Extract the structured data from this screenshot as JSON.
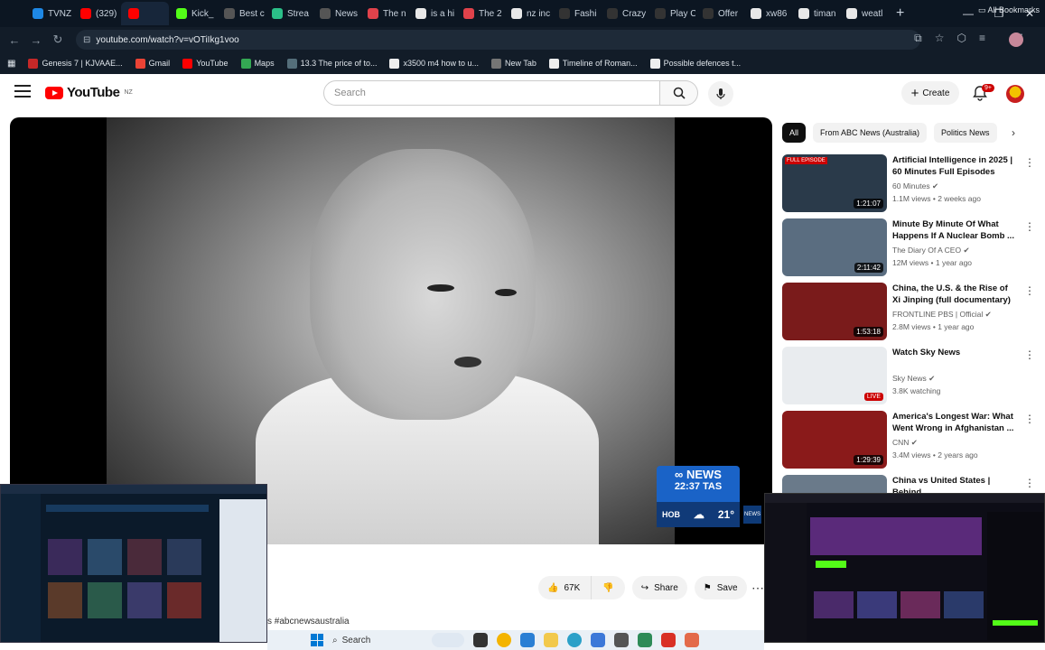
{
  "browser": {
    "tabs": [
      {
        "label": "TVNZ",
        "color": "#1e88e5"
      },
      {
        "label": "(329)",
        "color": "#ff0000"
      },
      {
        "label": "",
        "color": "#ff0000",
        "active": true
      },
      {
        "label": "Kick_",
        "color": "#53fc18"
      },
      {
        "label": "Best c",
        "color": "#555555"
      },
      {
        "label": "Strea",
        "color": "#2bbf88"
      },
      {
        "label": "News",
        "color": "#555555"
      },
      {
        "label": "The n",
        "color": "#e0424b"
      },
      {
        "label": "is a hi",
        "color": "#e8e8e8"
      },
      {
        "label": "The 2",
        "color": "#e0424b"
      },
      {
        "label": "nz inc",
        "color": "#e8e8e8"
      },
      {
        "label": "Fashi",
        "color": "#333333"
      },
      {
        "label": "Crazy",
        "color": "#333333"
      },
      {
        "label": "Play C",
        "color": "#333333"
      },
      {
        "label": "Offer",
        "color": "#333333"
      },
      {
        "label": "xw86",
        "color": "#e8e8e8"
      },
      {
        "label": "timan",
        "color": "#e8e8e8"
      },
      {
        "label": "weatl",
        "color": "#e8e8e8"
      }
    ],
    "new_tab": "+",
    "url": "youtube.com/watch?v=vOTiIkg1voo",
    "bookmarks": [
      {
        "label": "Genesis 7 | KJVAAE...",
        "color": "#c62828"
      },
      {
        "label": "Gmail",
        "color": "#ea4335"
      },
      {
        "label": "YouTube",
        "color": "#ff0000"
      },
      {
        "label": "Maps",
        "color": "#34a853"
      },
      {
        "label": "13.3 The price of to...",
        "color": "#546e7a"
      },
      {
        "label": "x3500 m4 how to u...",
        "color": "#eeeeee"
      },
      {
        "label": "New Tab",
        "color": "#757575"
      },
      {
        "label": "Timeline of Roman...",
        "color": "#eeeeee"
      },
      {
        "label": "Possible defences t...",
        "color": "#eeeeee"
      }
    ],
    "all_bookmarks": "All Bookmarks"
  },
  "youtube": {
    "logo_word": "YouTube",
    "logo_region": "NZ",
    "search_placeholder": "Search",
    "create_label": "Create",
    "notif_badge": "9+"
  },
  "video": {
    "overlay_brand": "NEWS",
    "overlay_time": "22:37 TAS",
    "overlay_city": "HOB",
    "overlay_temp": "21°",
    "likes": "67K",
    "share_label": "Share",
    "save_label": "Save",
    "hashtag": "s #abcnewsaustralia"
  },
  "sidebar": {
    "chips": [
      "All",
      "From ABC News (Australia)",
      "Politics News"
    ],
    "recommendations": [
      {
        "title": "Artificial Intelligence in 2025 | 60 Minutes Full Episodes",
        "channel": "60 Minutes",
        "meta": "1.1M views • 2 weeks ago",
        "duration": "1:21:07",
        "tag": "FULL EPISODE",
        "thumb": "#2a3a4a"
      },
      {
        "title": "Minute By Minute Of What Happens If A Nuclear Bomb ...",
        "channel": "The Diary Of A CEO",
        "meta": "12M views • 1 year ago",
        "duration": "2:11:42",
        "tag": "",
        "thumb": "#5a6d80"
      },
      {
        "title": "China, the U.S. & the Rise of Xi Jinping (full documentary) | ...",
        "channel": "FRONTLINE PBS | Official",
        "meta": "2.8M views • 1 year ago",
        "duration": "1:53:18",
        "tag": "",
        "thumb": "#7a1b1b"
      },
      {
        "title": "Watch Sky News",
        "channel": "Sky News",
        "meta": "3.8K watching",
        "duration": "LIVE",
        "tag": "",
        "thumb": "#e9ecef"
      },
      {
        "title": "America's Longest War: What Went Wrong in Afghanistan ...",
        "channel": "CNN",
        "meta": "3.4M views • 2 years ago",
        "duration": "1:29:39",
        "tag": "",
        "thumb": "#8a1a1a"
      },
      {
        "title": "China vs United States | Behind",
        "channel": "",
        "meta": "",
        "duration": "",
        "tag": "",
        "thumb": "#6a7a8a"
      }
    ]
  },
  "taskbar": {
    "search_label": "Search"
  }
}
